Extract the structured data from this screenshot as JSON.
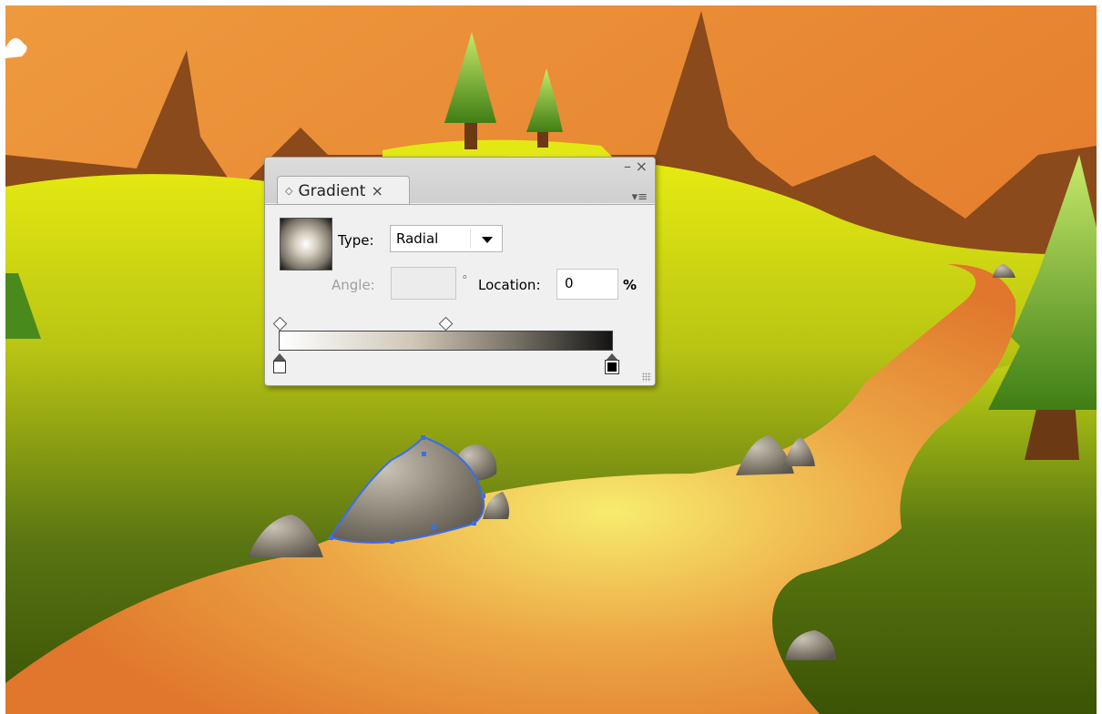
{
  "gradient_panel": {
    "tab_title": "Gradient",
    "tab_updown_glyph": "◇",
    "tab_close_glyph": "×",
    "minimize_glyph": "–",
    "close_glyph": "×",
    "menu_glyph": "▾≡",
    "type_label": "Type:",
    "type_value": "Radial",
    "angle_label": "Angle:",
    "angle_value": "",
    "degree_symbol": "°",
    "location_label": "Location:",
    "location_value": "0",
    "percent_symbol": "%"
  },
  "icons": [
    "gradient-thumbnail-icon",
    "chevron-down-icon",
    "gradient-stop-white-icon",
    "gradient-stop-black-icon",
    "midpoint-diamond-icon",
    "resize-grip-icon"
  ],
  "colors": {
    "sky_orange": "#e8862f",
    "mountains_brown": "#8b4a1b",
    "hill_yellow_green": "#d8e21a",
    "hill_dark_green": "#3f5a07",
    "path_orange": "#e59a3a",
    "path_highlight": "#f5e46a",
    "rock_gray": "#8a847a",
    "selection_blue": "#3b6ee8"
  }
}
